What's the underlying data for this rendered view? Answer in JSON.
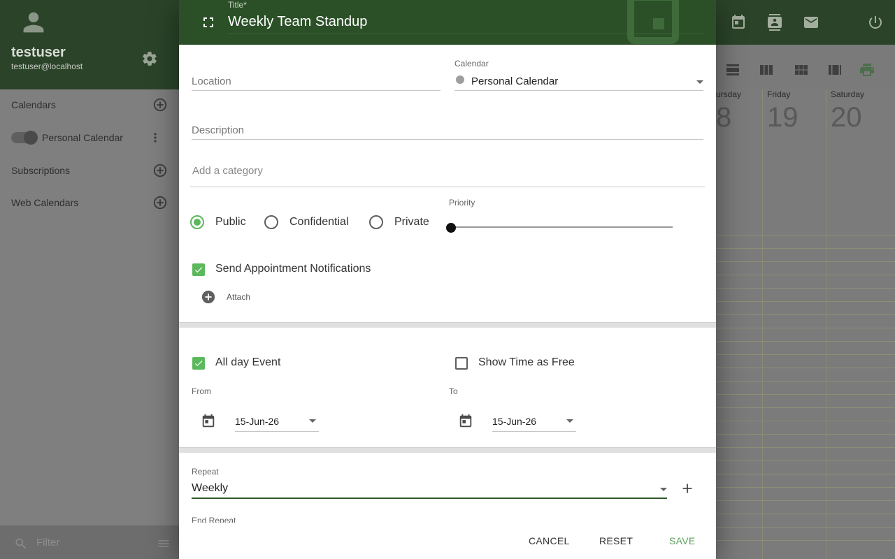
{
  "sidebar": {
    "user_name": "testuser",
    "user_email": "testuser@localhost",
    "calendars_label": "Calendars",
    "personal_calendar_label": "Personal Calendar",
    "subscriptions_label": "Subscriptions",
    "web_calendars_label": "Web Calendars",
    "filter_placeholder": "Filter"
  },
  "calendar_view": {
    "days": [
      {
        "name": "ursday",
        "number": "8"
      },
      {
        "name": "Friday",
        "number": "19"
      },
      {
        "name": "Saturday",
        "number": "20"
      }
    ]
  },
  "dialog": {
    "title_label": "Title*",
    "title_value": "Weekly Team Standup",
    "location_placeholder": "Location",
    "calendar_label": "Calendar",
    "calendar_value": "Personal Calendar",
    "description_placeholder": "Description",
    "category_placeholder": "Add a category",
    "privacy": {
      "public": "Public",
      "confidential": "Confidential",
      "private": "Private",
      "selected": "public"
    },
    "priority_label": "Priority",
    "priority_value": 0,
    "send_notifications_label": "Send Appointment Notifications",
    "send_notifications_checked": true,
    "attach_label": "Attach",
    "all_day_label": "All day Event",
    "all_day_checked": true,
    "show_free_label": "Show Time as Free",
    "show_free_checked": false,
    "from_label": "From",
    "from_value": "15-Jun-26",
    "to_label": "To",
    "to_value": "15-Jun-26",
    "repeat_label": "Repeat",
    "repeat_value": "Weekly",
    "end_repeat_label": "End Repeat",
    "buttons": {
      "cancel": "CANCEL",
      "reset": "RESET",
      "save": "SAVE"
    }
  },
  "colors": {
    "header_green": "#2b5027",
    "accent_green": "#5cb85c",
    "dim_overlay": "#7a7a7a"
  }
}
